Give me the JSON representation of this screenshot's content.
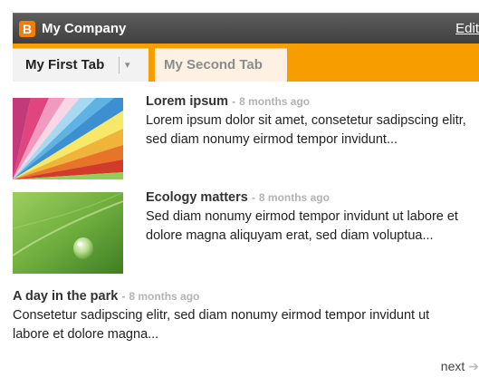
{
  "header": {
    "logo_letter": "B",
    "title": "My Company",
    "edit_label": "Edit"
  },
  "tabs": [
    {
      "label": "My First Tab",
      "active": true
    },
    {
      "label": "My Second Tab",
      "active": false
    }
  ],
  "dash": "-",
  "posts": [
    {
      "title": "Lorem ipsum",
      "time": "8 months ago",
      "excerpt": "Lorem ipsum dolor sit amet, consetetur sadipscing elitr, sed diam nonumy eirmod tempor invidunt...",
      "thumb": "color-swatch-fan"
    },
    {
      "title": "Ecology matters",
      "time": "8 months ago",
      "excerpt": "Sed diam nonumy eirmod tempor invidunt ut labore et dolore magna aliquyam erat, sed diam voluptua...",
      "thumb": "green-leaf-droplet"
    },
    {
      "title": "A day in the park",
      "time": "8 months ago",
      "excerpt": "Consetetur sadipscing elitr, sed diam nonumy eirmod tempor invidunt ut labore et dolore magna..."
    }
  ],
  "pager": {
    "next_label": "next",
    "arrow_icon": "right-arrow-icon"
  },
  "colors": {
    "header_bg": "#4e4e4e",
    "accent_orange": "#f79d00",
    "logo_orange": "#f57d00"
  }
}
